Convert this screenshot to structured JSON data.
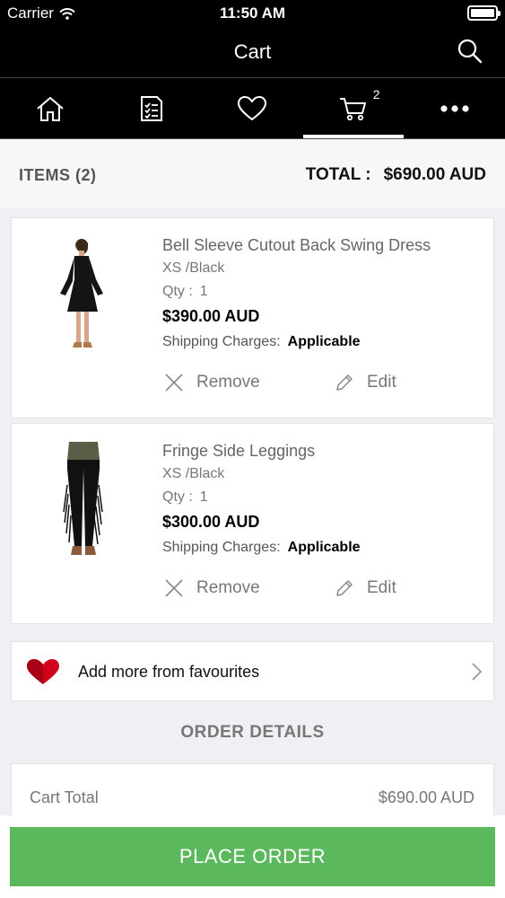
{
  "status_bar": {
    "carrier": "Carrier",
    "time": "11:50 AM"
  },
  "nav": {
    "title": "Cart"
  },
  "tabs": [
    {
      "icon": "home-icon"
    },
    {
      "icon": "orders-list-icon"
    },
    {
      "icon": "heart-icon"
    },
    {
      "icon": "cart-icon",
      "badge": "2",
      "active": true
    },
    {
      "icon": "more-icon"
    }
  ],
  "summary": {
    "items_label": "ITEMS",
    "items_count": "(2)",
    "total_label": "TOTAL :",
    "total_value": "$690.00 AUD"
  },
  "cart_items": [
    {
      "name": "Bell Sleeve Cutout Back Swing Dress",
      "variant": "XS /Black",
      "qty_label": "Qty :",
      "qty": "1",
      "price": "$390.00 AUD",
      "shipping_label": "Shipping Charges:",
      "shipping_value": "Applicable",
      "remove_label": "Remove",
      "edit_label": "Edit"
    },
    {
      "name": "Fringe Side Leggings",
      "variant": "XS /Black",
      "qty_label": "Qty :",
      "qty": "1",
      "price": "$300.00 AUD",
      "shipping_label": "Shipping Charges:",
      "shipping_value": "Applicable",
      "remove_label": "Remove",
      "edit_label": "Edit"
    }
  ],
  "favourites": {
    "label": "Add more from favourites"
  },
  "order_details": {
    "title": "ORDER DETAILS",
    "cart_total_label": "Cart Total",
    "cart_total_value": "$690.00 AUD"
  },
  "place_order": {
    "label": "PLACE ORDER"
  },
  "colors": {
    "accent_green": "#5cb85c",
    "heart_red": "#d0021b",
    "bar_black": "#000000"
  }
}
